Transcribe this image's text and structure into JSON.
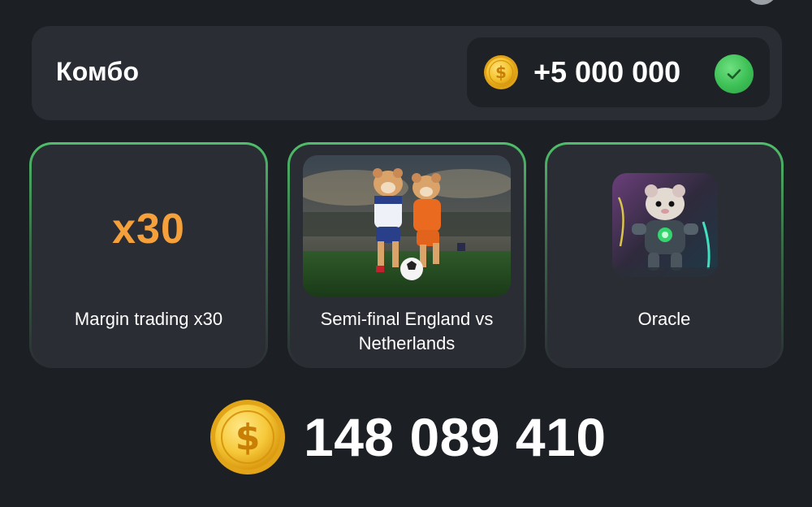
{
  "combo": {
    "title": "Комбо",
    "reward": "+5 000 000",
    "status": "completed"
  },
  "cards": [
    {
      "badge_text": "x30",
      "label": "Margin trading x30"
    },
    {
      "label_line1": "Semi-final England vs",
      "label_line2": "Netherlands"
    },
    {
      "label": "Oracle"
    }
  ],
  "balance": {
    "amount": "148 089 410"
  },
  "colors": {
    "background": "#1c1f24",
    "panel": "#2a2d33",
    "accent_orange": "#f5a03a",
    "check_green": "#3cbf55",
    "card_border_green": "#4fbf6a",
    "coin_gold": "#f4c430"
  },
  "icons": {
    "coin": "dollar-coin-icon",
    "check": "checkmark-icon"
  }
}
